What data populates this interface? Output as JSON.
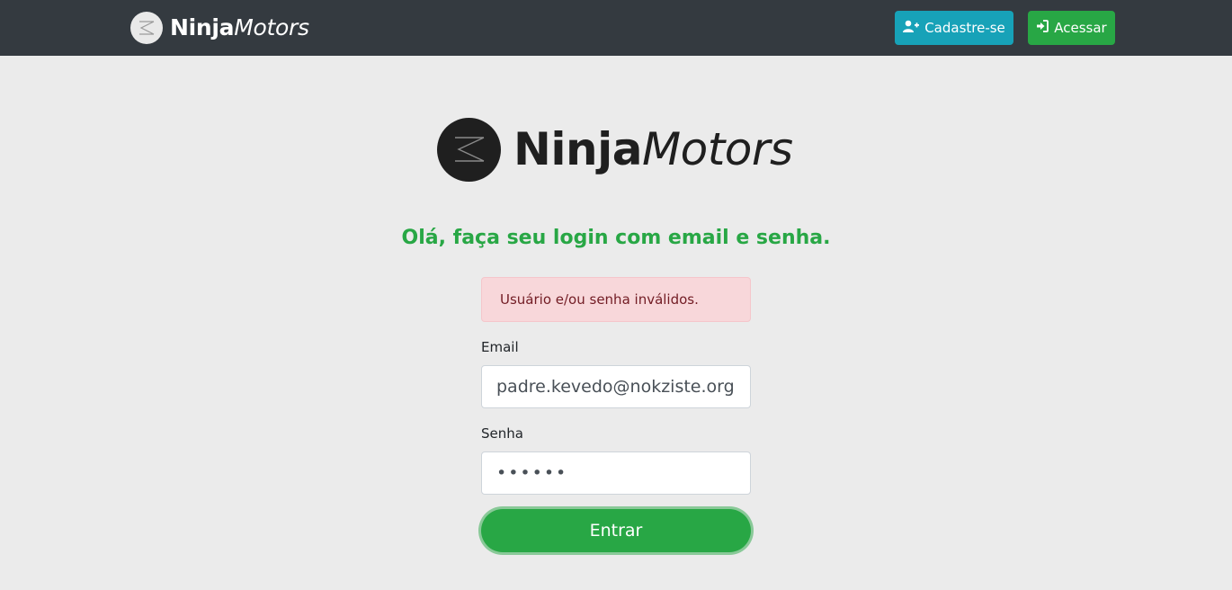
{
  "colors": {
    "navbar_bg": "#343a40",
    "page_bg": "#ebebeb",
    "accent_green": "#28a745",
    "info_blue": "#17a2b8",
    "alert_bg": "#f8d7da",
    "alert_text": "#721c24"
  },
  "navbar": {
    "brand": {
      "bold": "Ninja",
      "light": "Motors"
    },
    "signup_label": "Cadastre-se",
    "signup_icon": "user-plus-icon",
    "access_label": "Acessar",
    "access_icon": "sign-in-icon"
  },
  "hero": {
    "brand": {
      "bold": "Ninja",
      "light": "Motors"
    },
    "logo_icon": "ninjamotors-logo-icon"
  },
  "login": {
    "heading": "Olá, faça seu login com email e senha.",
    "alert": "Usuário e/ou senha inválidos.",
    "email_label": "Email",
    "email_value": "padre.kevedo@nokziste.org",
    "password_label": "Senha",
    "password_value": "••••••",
    "submit_label": "Entrar"
  }
}
